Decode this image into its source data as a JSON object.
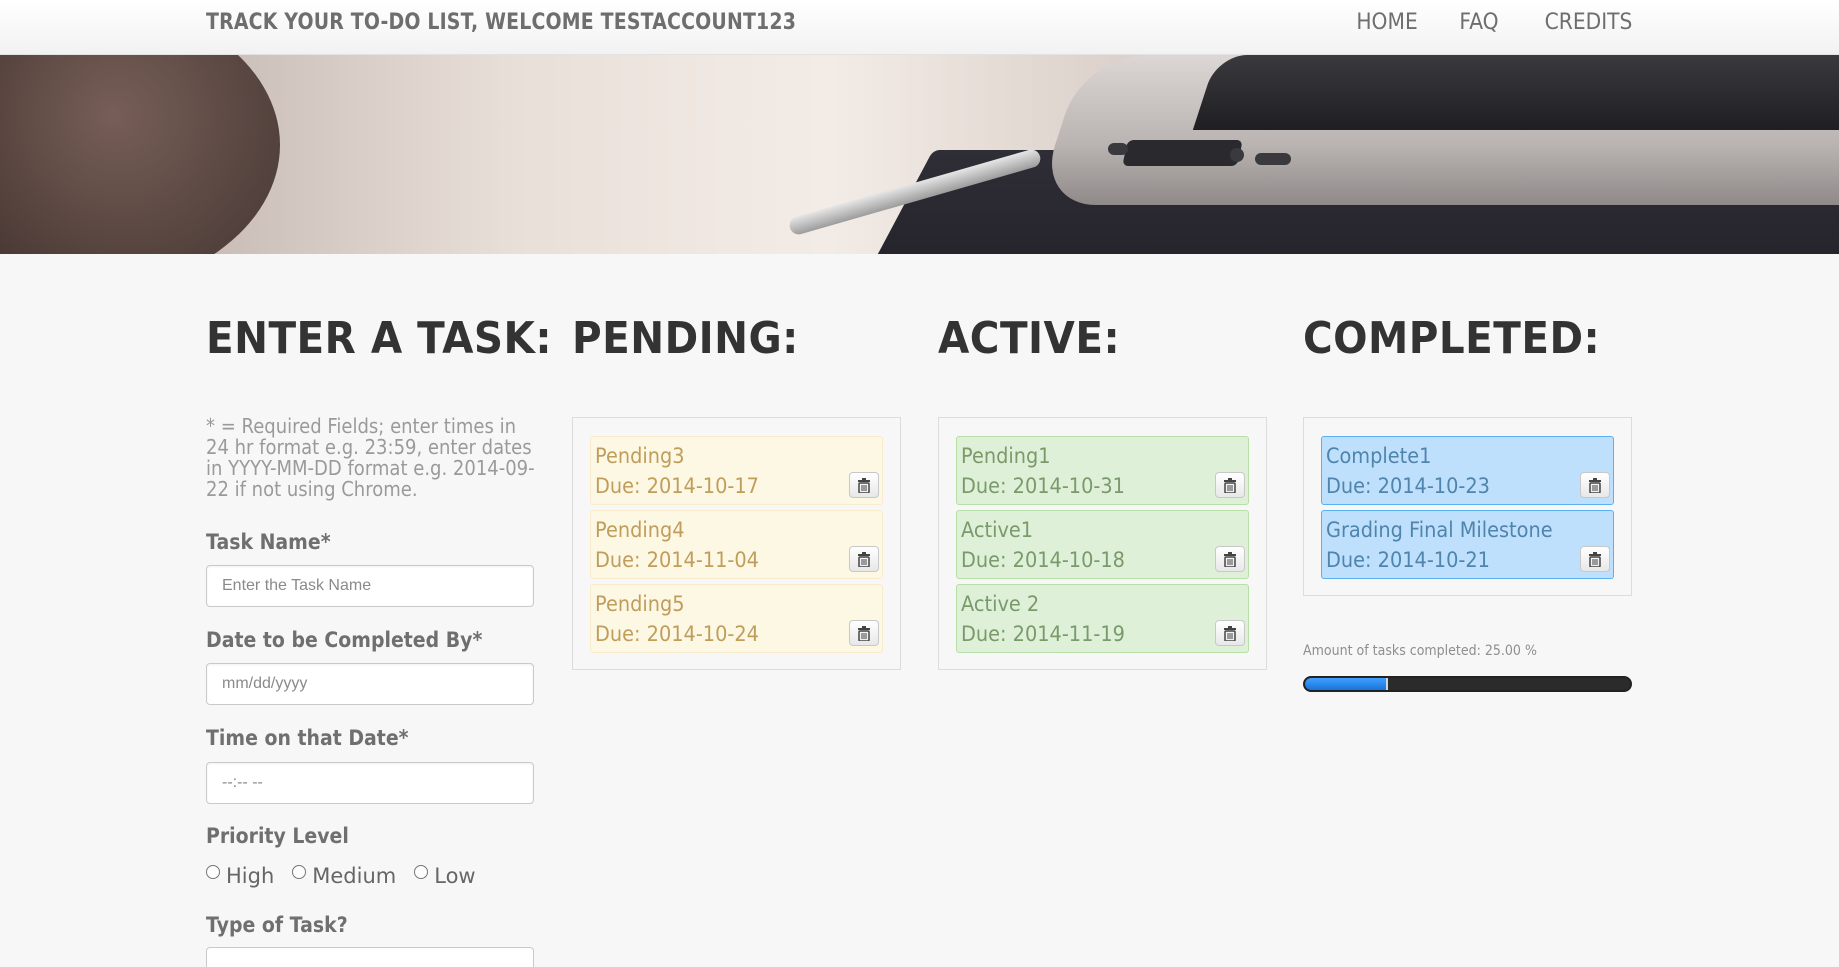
{
  "navbar": {
    "brand": "TRACK YOUR TO-DO LIST, WELCOME TESTACCOUNT123",
    "links": [
      "HOME",
      "FAQ",
      "CREDITS"
    ]
  },
  "enter": {
    "title": "ENTER A TASK:",
    "help": "* = Required Fields; enter times in 24 hr format e.g. 23:59, enter dates in YYYY-MM-DD format e.g. 2014-09-22 if not using Chrome.",
    "task_name_label": "Task Name*",
    "task_name_placeholder": "Enter the Task Name",
    "date_label": "Date to be Completed By*",
    "date_placeholder": "mm/dd/yyyy",
    "time_label": "Time on that Date*",
    "time_placeholder": "--:-- --",
    "priority_label": "Priority Level",
    "priority_options": [
      "High",
      "Medium",
      "Low"
    ],
    "type_label": "Type of Task?"
  },
  "pending": {
    "title": "PENDING:",
    "tasks": [
      {
        "name": "Pending3",
        "due": "Due: 2014-10-17"
      },
      {
        "name": "Pending4",
        "due": "Due: 2014-11-04"
      },
      {
        "name": "Pending5",
        "due": "Due: 2014-10-24"
      }
    ]
  },
  "active": {
    "title": "ACTIVE:",
    "tasks": [
      {
        "name": "Pending1",
        "due": "Due: 2014-10-31"
      },
      {
        "name": "Active1",
        "due": "Due: 2014-10-18"
      },
      {
        "name": "Active 2",
        "due": "Due: 2014-11-19"
      }
    ]
  },
  "completed": {
    "title": "COMPLETED:",
    "tasks": [
      {
        "name": "Complete1",
        "due": "Due: 2014-10-23"
      },
      {
        "name": "Grading Final Milestone",
        "due": "Due: 2014-10-21"
      }
    ],
    "progress_label": "Amount of tasks completed: 25.00 %",
    "progress_percent": 25
  },
  "icons": {
    "delete": "trash-icon"
  },
  "colors": {
    "pending_bg": "#fcf8e3",
    "active_bg": "#dff0d8",
    "completed_bg": "#bfe0fc",
    "progress_fill": "#1a73d9"
  }
}
